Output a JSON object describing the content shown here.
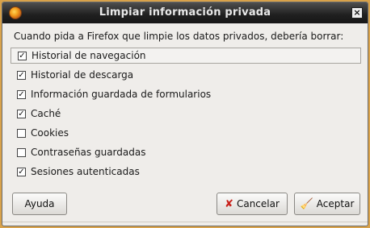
{
  "window": {
    "title": "Limpiar información privada",
    "close_symbol": "×"
  },
  "dialog": {
    "prompt": "Cuando pida a Firefox que limpie los datos privados, debería borrar:",
    "options": [
      {
        "label": "Historial de navegación",
        "checked": true
      },
      {
        "label": "Historial de descarga",
        "checked": true
      },
      {
        "label": "Información guardada de formularios",
        "checked": true
      },
      {
        "label": "Caché",
        "checked": true
      },
      {
        "label": "Cookies",
        "checked": false
      },
      {
        "label": "Contraseñas guardadas",
        "checked": false
      },
      {
        "label": "Sesiones autenticadas",
        "checked": true
      }
    ]
  },
  "buttons": {
    "help": "Ayuda",
    "cancel": "Cancelar",
    "accept": "Aceptar"
  },
  "icons": {
    "app": "firefox-icon",
    "cancel": "cross-icon",
    "accept": "broom-icon"
  }
}
